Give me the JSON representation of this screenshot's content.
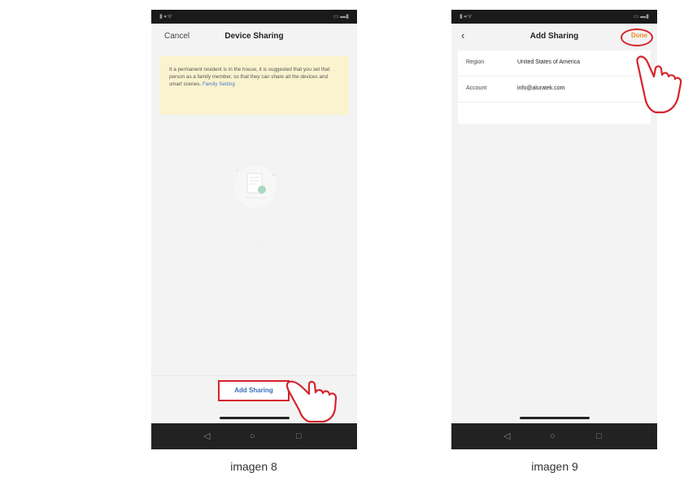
{
  "screen1": {
    "header": {
      "cancel_label": "Cancel",
      "title": "Device Sharing"
    },
    "notice": {
      "text": "It a permanent resident is in the house, it is suggested that you set that person as a family member, so that they can share all the devices and smart scenes.",
      "link": "Family Setting"
    },
    "add_button_label": "Add Sharing",
    "caption": "imagen 8"
  },
  "screen2": {
    "header": {
      "title": "Add Sharing",
      "done_label": "Done"
    },
    "fields": [
      {
        "label": "Region",
        "value": "United States of America"
      },
      {
        "label": "Account",
        "value": "info@aluratek.com"
      }
    ],
    "caption": "imagen 9"
  },
  "colors": {
    "accent_orange": "#f08a24",
    "highlight_red": "#d6232a",
    "link_blue": "#3a6fb8",
    "notice_bg": "#fbf3cf"
  }
}
